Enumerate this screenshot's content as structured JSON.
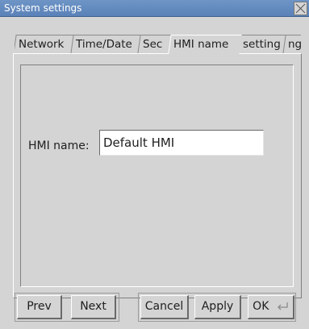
{
  "window": {
    "title": "System settings",
    "close_icon": "close-icon"
  },
  "tabs": [
    {
      "label": "Network",
      "active": false
    },
    {
      "label": "Time/Date",
      "active": false
    },
    {
      "label": "Sec",
      "active": false
    },
    {
      "label": "HMI name",
      "active": true
    },
    {
      "label": "setting",
      "active": false
    },
    {
      "label": "ng",
      "active": false
    }
  ],
  "form": {
    "hmi_name_label": "HMI name:",
    "hmi_name_value": "Default HMI"
  },
  "buttons": {
    "prev": "Prev",
    "next": "Next",
    "cancel": "Cancel",
    "apply": "Apply",
    "ok": "OK",
    "ok_icon": "enter-icon"
  },
  "colors": {
    "titlebar": "#5a82b8",
    "background": "#d4d4d4"
  }
}
